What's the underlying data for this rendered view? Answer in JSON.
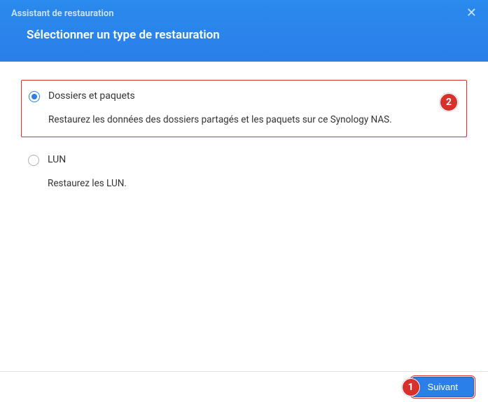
{
  "header": {
    "wizard_title": "Assistant de restauration",
    "step_title": "Sélectionner un type de restauration"
  },
  "options": {
    "folders": {
      "title": "Dossiers et paquets",
      "desc": "Restaurez les données des dossiers partagés et les paquets sur ce Synology NAS."
    },
    "lun": {
      "title": "LUN",
      "desc": "Restaurez les LUN."
    }
  },
  "annotations": {
    "badge1": "1",
    "badge2": "2"
  },
  "footer": {
    "next_label": "Suivant"
  },
  "colors": {
    "accent": "#2a7fe8",
    "annotation": "#d8302a"
  }
}
